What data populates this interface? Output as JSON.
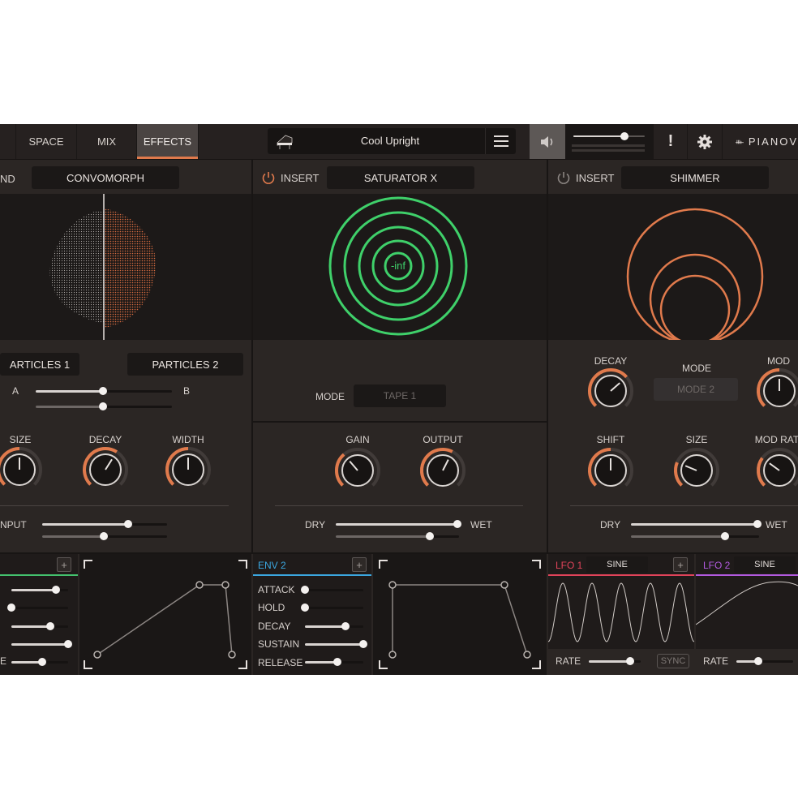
{
  "tabs": [
    {
      "label": "SPACE"
    },
    {
      "label": "MIX"
    },
    {
      "label": "EFFECTS"
    }
  ],
  "preset": {
    "name": "Cool Upright"
  },
  "brand": {
    "label": "PIANOV"
  },
  "alert_label": "!",
  "colors": {
    "accent": "#e07a4c",
    "green": "#3fd06a",
    "env_blue": "#3ba7e0",
    "lfo_red": "#e0435a",
    "lfo_purple": "#b25adf",
    "env_green": "#44c26e"
  },
  "volume": {
    "level": 0.72
  },
  "slots": [
    {
      "type_label": "ND",
      "effect": "CONVOMORPH",
      "particles": [
        "ARTICLES 1",
        "PARTICLES 2"
      ],
      "ab": [
        "A",
        "B"
      ],
      "knobs": [
        {
          "label": "SIZE",
          "value": 0.5
        },
        {
          "label": "DECAY",
          "value": 0.62
        },
        {
          "label": "WIDTH",
          "value": 0.5
        }
      ],
      "input_label": "NPUT"
    },
    {
      "type_label": "INSERT",
      "effect": "SATURATOR X",
      "meter": "-inf",
      "mode_label": "MODE",
      "mode_value": "TAPE 1",
      "knobs": [
        {
          "label": "GAIN",
          "value": 0.35
        },
        {
          "label": "OUTPUT",
          "value": 0.6
        }
      ],
      "dry_label": "DRY",
      "wet_label": "WET"
    },
    {
      "type_label": "INSERT",
      "effect": "SHIMMER",
      "knobs_top": [
        {
          "label": "DECAY",
          "value": 0.68
        },
        {
          "label": "MOD",
          "value": 0.5
        }
      ],
      "mode_label": "MODE",
      "mode_value": "MODE 2",
      "knobs": [
        {
          "label": "SHIFT",
          "value": 0.5
        },
        {
          "label": "SIZE",
          "value": 0.25
        },
        {
          "label": "MOD RAT",
          "value": 0.3
        }
      ],
      "dry_label": "DRY",
      "wet_label": "WET"
    }
  ],
  "env1": {
    "rows": [
      {
        "label": ""
      },
      {
        "label": ""
      },
      {
        "label": ""
      },
      {
        "label": ""
      },
      {
        "label": "E"
      }
    ]
  },
  "env2": {
    "title": "ENV 2",
    "rows": [
      {
        "label": "ATTACK"
      },
      {
        "label": "HOLD"
      },
      {
        "label": "DECAY"
      },
      {
        "label": "SUSTAIN"
      },
      {
        "label": "RELEASE"
      }
    ]
  },
  "lfo1": {
    "title": "LFO 1",
    "wave": "SINE",
    "rate_label": "RATE",
    "sync_label": "SYNC"
  },
  "lfo2": {
    "title": "LFO 2",
    "wave": "SINE",
    "rate_label": "RATE"
  },
  "plus_label": "+"
}
